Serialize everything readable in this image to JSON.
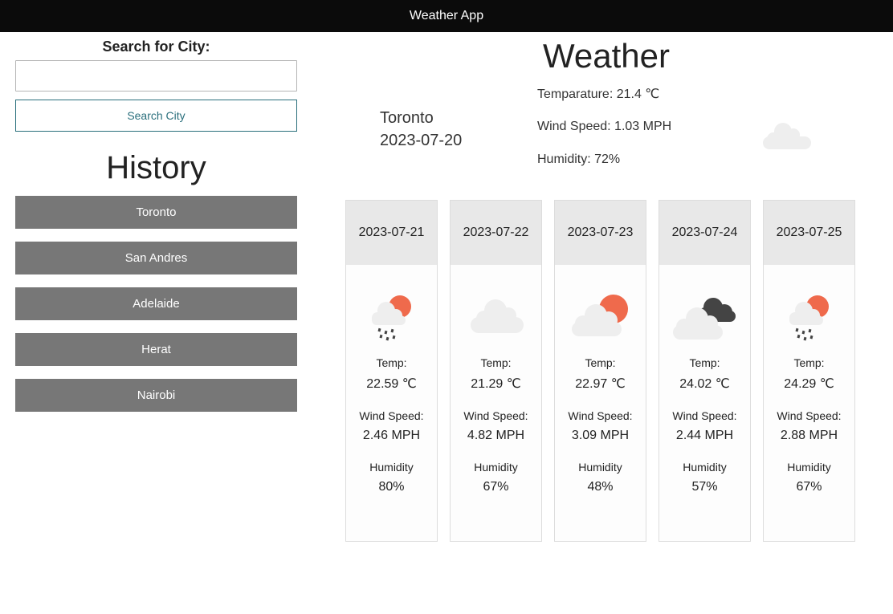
{
  "app_title": "Weather App",
  "search": {
    "label": "Search for City:",
    "input_value": "",
    "button_label": "Search City"
  },
  "history": {
    "title": "History",
    "items": [
      "Toronto",
      "San Andres",
      "Adelaide",
      "Herat",
      "Nairobi"
    ]
  },
  "current": {
    "title": "Weather",
    "city": "Toronto",
    "date": "2023-07-20",
    "temperature": "Temparature: 21.4 ℃",
    "wind": "Wind Speed: 1.03 MPH",
    "humidity": "Humidity: 72%",
    "icon": "cloud-icon"
  },
  "forecast": [
    {
      "date": "2023-07-21",
      "icon": "sun-rain-icon",
      "temp_label": "Temp:",
      "temp": "22.59 ℃",
      "wind_label": "Wind Speed:",
      "wind": "2.46 MPH",
      "humidity_label": "Humidity",
      "humidity": "80%"
    },
    {
      "date": "2023-07-22",
      "icon": "cloud-icon",
      "temp_label": "Temp:",
      "temp": "21.29 ℃",
      "wind_label": "Wind Speed:",
      "wind": "4.82 MPH",
      "humidity_label": "Humidity",
      "humidity": "67%"
    },
    {
      "date": "2023-07-23",
      "icon": "partly-cloudy-icon",
      "temp_label": "Temp:",
      "temp": "22.97 ℃",
      "wind_label": "Wind Speed:",
      "wind": "3.09 MPH",
      "humidity_label": "Humidity",
      "humidity": "48%"
    },
    {
      "date": "2023-07-24",
      "icon": "dark-clouds-icon",
      "temp_label": "Temp:",
      "temp": "24.02 ℃",
      "wind_label": "Wind Speed:",
      "wind": "2.44 MPH",
      "humidity_label": "Humidity",
      "humidity": "57%"
    },
    {
      "date": "2023-07-25",
      "icon": "sun-rain-icon",
      "temp_label": "Temp:",
      "temp": "24.29 ℃",
      "wind_label": "Wind Speed:",
      "wind": "2.88 MPH",
      "humidity_label": "Humidity",
      "humidity": "67%"
    }
  ],
  "colors": {
    "topbar": "#0b0b0b",
    "history_button": "#777777",
    "accent": "#2a6f7c",
    "sun": "#ef6a4c",
    "cloud": "#eeeeee",
    "dark_cloud": "#444444"
  }
}
